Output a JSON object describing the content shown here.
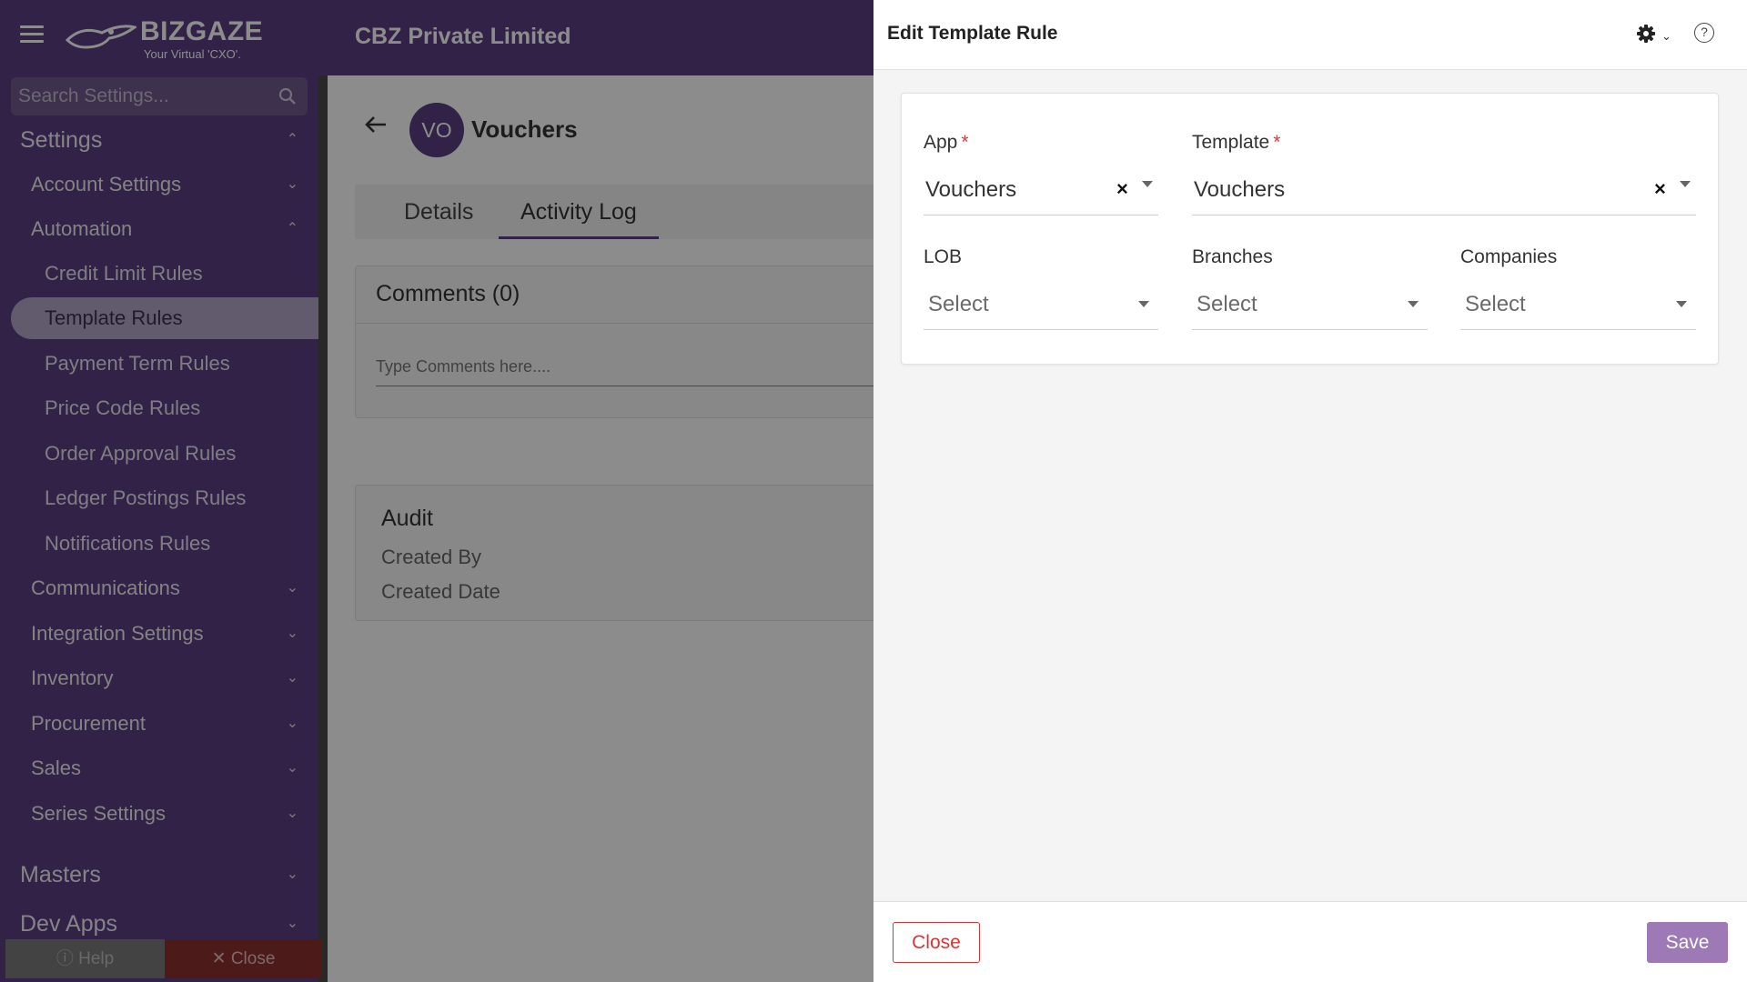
{
  "header": {
    "logo_brand": "BIZGAZE",
    "logo_tagline": "Your Virtual 'CXO'.",
    "company_name": "CBZ Private Limited"
  },
  "sidebar": {
    "search_placeholder": "Search Settings...",
    "items": [
      {
        "label": "Settings",
        "level": 0,
        "state": "expanded"
      },
      {
        "label": "Account Settings",
        "level": 1,
        "state": "collapsed"
      },
      {
        "label": "Automation",
        "level": 1,
        "state": "expanded"
      },
      {
        "label": "Credit Limit Rules",
        "level": 2
      },
      {
        "label": "Template Rules",
        "level": 2,
        "active": true
      },
      {
        "label": "Payment Term Rules",
        "level": 2
      },
      {
        "label": "Price Code Rules",
        "level": 2
      },
      {
        "label": "Order Approval Rules",
        "level": 2
      },
      {
        "label": "Ledger Postings Rules",
        "level": 2
      },
      {
        "label": "Notifications Rules",
        "level": 2
      },
      {
        "label": "Communications",
        "level": 1,
        "state": "collapsed"
      },
      {
        "label": "Integration Settings",
        "level": 1,
        "state": "collapsed"
      },
      {
        "label": "Inventory",
        "level": 1,
        "state": "collapsed"
      },
      {
        "label": "Procurement",
        "level": 1,
        "state": "collapsed"
      },
      {
        "label": "Sales",
        "level": 1,
        "state": "collapsed"
      },
      {
        "label": "Series Settings",
        "level": 1,
        "state": "collapsed"
      },
      {
        "label": "Masters",
        "level": 0,
        "state": "collapsed"
      },
      {
        "label": "Dev Apps",
        "level": 0,
        "state": "collapsed"
      }
    ],
    "help_label": "Help",
    "close_label": "Close"
  },
  "main": {
    "avatar_initials": "VO",
    "title": "Vouchers",
    "tabs": [
      {
        "label": "Details",
        "active": false
      },
      {
        "label": "Activity Log",
        "active": true
      }
    ],
    "comments_title": "Comments (0)",
    "comment_placeholder": "Type Comments here....",
    "audit_title": "Audit",
    "audit_rows": [
      "Created By",
      "Created Date"
    ]
  },
  "drawer": {
    "title": "Edit Template Rule",
    "fields": {
      "app": {
        "label": "App",
        "required": true,
        "value": "Vouchers"
      },
      "template": {
        "label": "Template",
        "required": true,
        "value": "Vouchers"
      },
      "lob": {
        "label": "LOB",
        "placeholder": "Select"
      },
      "branches": {
        "label": "Branches",
        "placeholder": "Select"
      },
      "companies": {
        "label": "Companies",
        "placeholder": "Select"
      }
    },
    "close_label": "Close",
    "save_label": "Save"
  },
  "icons": {
    "menu": "hamburger-icon",
    "search": "search-icon",
    "back": "back-arrow-icon",
    "settings": "gear-icon",
    "help": "help-icon",
    "clear": "clear-icon",
    "dropdown": "caret-down-icon"
  },
  "colors": {
    "brand_purple": "#5e3f83",
    "save_button": "#9d79b6",
    "close_button": "#dd3333",
    "required_marker": "#ee3333"
  }
}
